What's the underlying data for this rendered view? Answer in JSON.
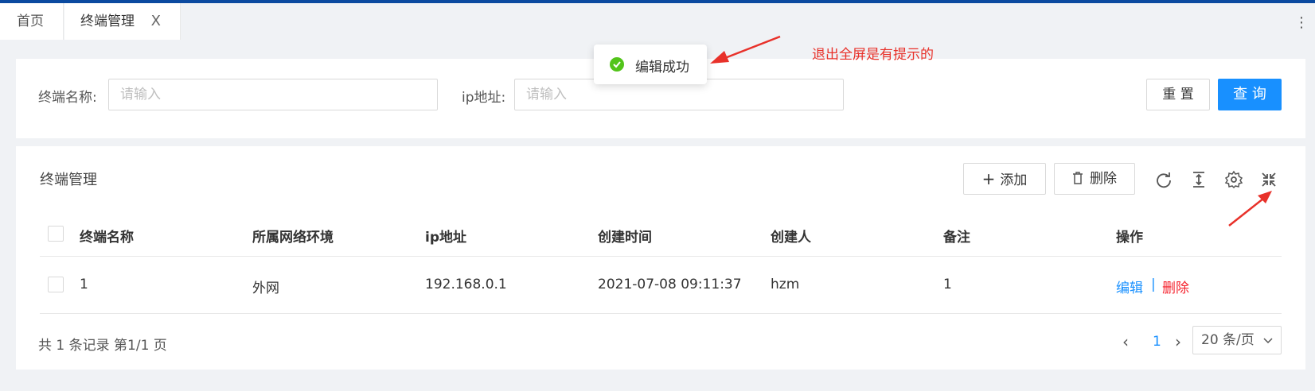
{
  "tabs": [
    {
      "label": "首页"
    },
    {
      "label": "终端管理",
      "close": "X"
    }
  ],
  "more_icon": "⋮",
  "search": {
    "name_label": "终端名称:",
    "name_placeholder": "请输入",
    "ip_label": "ip地址:",
    "ip_placeholder": "请输入",
    "reset_label": "重 置",
    "query_label": "查 询"
  },
  "toast": {
    "message": "编辑成功",
    "icon": "check-circle-icon",
    "color": "#52c41a"
  },
  "annotation": {
    "text": "退出全屏是有提示的",
    "color": "#e8312a"
  },
  "table": {
    "title": "终端管理",
    "add_label": "添加",
    "delete_label": "删除",
    "toolbar_icons": [
      "refresh-icon",
      "column-height-icon",
      "settings-icon",
      "fullscreen-exit-icon"
    ],
    "columns": [
      "终端名称",
      "所属网络环境",
      "ip地址",
      "创建时间",
      "创建人",
      "备注",
      "操作"
    ],
    "rows": [
      {
        "name": "1",
        "network": "外网",
        "ip": "192.168.0.1",
        "created_at": "2021-07-08 09:11:37",
        "creator": "hzm",
        "remark": "1",
        "edit": "编辑",
        "separator": "|",
        "delete": "删除"
      }
    ]
  },
  "pagination": {
    "summary": "共 1 条记录 第1/1 页",
    "current_page": "1",
    "page_size": "20 条/页"
  },
  "colors": {
    "accent": "#1890ff",
    "danger": "#f5222d",
    "topline": "#0b4aa0"
  }
}
